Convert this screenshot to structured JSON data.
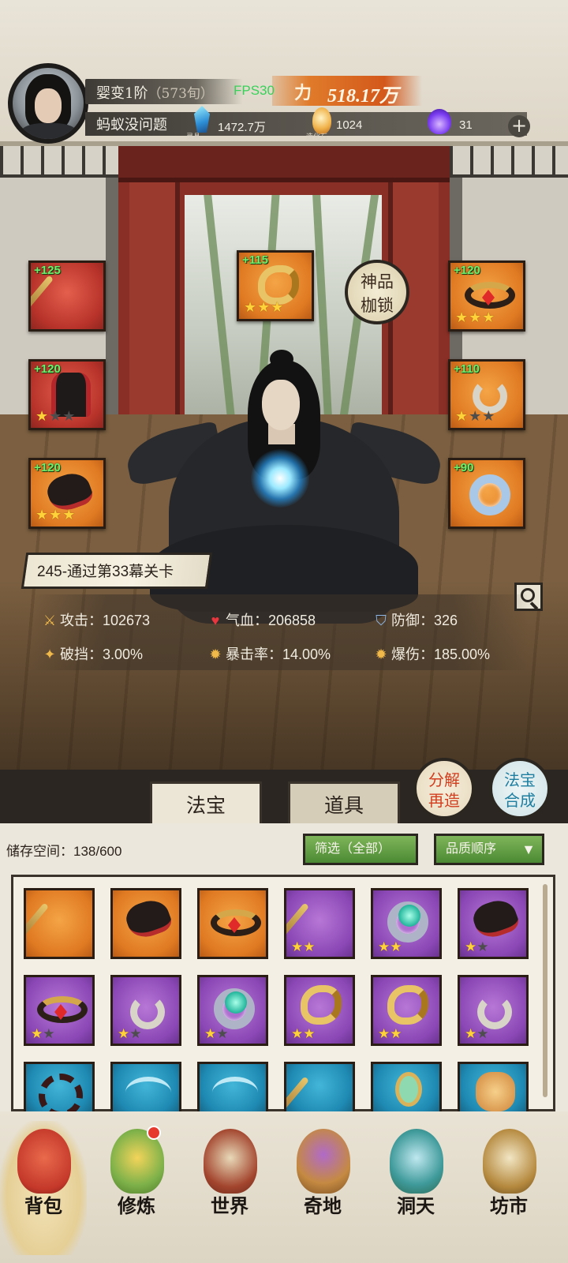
{
  "header": {
    "realm": "婴变1阶",
    "realm_age": "（573旬）",
    "fps": "FPS30",
    "power_label": "力",
    "power_value": "518.17万",
    "player_name": "蚂蚁没问题",
    "resources": [
      {
        "icon": "spirit-crystal-icon",
        "caption": "灵晶",
        "value": "1472.7万"
      },
      {
        "icon": "creation-stone-icon",
        "caption": "造化石",
        "value": "1024"
      },
      {
        "icon": "soul-flame-icon",
        "caption": "",
        "value": "31"
      }
    ],
    "plus_label": "+"
  },
  "equipment": {
    "slots": [
      {
        "bonus": "+125",
        "stars": 0,
        "max_stars": 0,
        "color": "#c0382d",
        "icon": "staff-icon"
      },
      {
        "bonus": "+115",
        "stars": 3,
        "max_stars": 3,
        "color": "#e07a22",
        "icon": "dragon-talisman-icon"
      },
      {
        "bonus": "+120",
        "stars": 3,
        "max_stars": 3,
        "color": "#e07a22",
        "icon": "crown-icon"
      },
      {
        "bonus": "+120",
        "stars": 1,
        "max_stars": 3,
        "color": "#c0382d",
        "icon": "robe-icon"
      },
      {
        "bonus": "+110",
        "stars": 1,
        "max_stars": 3,
        "color": "#e07a22",
        "icon": "pendant-icon"
      },
      {
        "bonus": "+120",
        "stars": 3,
        "max_stars": 3,
        "color": "#e07a22",
        "icon": "gauntlet-icon"
      },
      {
        "bonus": "+90",
        "stars": 0,
        "max_stars": 0,
        "color": "#e07a22",
        "icon": "ice-ring-icon"
      }
    ],
    "god_badge_line1": "神品",
    "god_badge_line2": "枷锁"
  },
  "stage": "245-通过第33幕关卡",
  "stats": {
    "attack": "攻击：102673",
    "hp": "气血：206858",
    "defense": "防御：326",
    "break": "破挡：3.00%",
    "crit_rate": "暴击率：14.00%",
    "crit_damage": "爆伤：185.00%"
  },
  "tabs": {
    "treasure": "法宝",
    "items": "道具"
  },
  "actions": {
    "decompose_line1": "分解",
    "decompose_line2": "再造",
    "synth_line1": "法宝",
    "synth_line2": "合成"
  },
  "inventory": {
    "storage": "储存空间：138/600",
    "filter": "筛选（全部）",
    "sort": "品质顺序",
    "cells": [
      {
        "rarity": "orange",
        "icon": "staff-icon",
        "stars": 0
      },
      {
        "rarity": "orange",
        "icon": "gauntlet-icon",
        "stars": 0
      },
      {
        "rarity": "orange",
        "icon": "crown-icon",
        "stars": 0
      },
      {
        "rarity": "purple",
        "icon": "staff-icon",
        "stars": 2
      },
      {
        "rarity": "purple",
        "icon": "jade-ring-icon",
        "stars": 2
      },
      {
        "rarity": "purple",
        "icon": "gauntlet-icon",
        "stars": 1
      },
      {
        "rarity": "purple",
        "icon": "crown-icon",
        "stars": 1
      },
      {
        "rarity": "purple",
        "icon": "pendant-icon",
        "stars": 1
      },
      {
        "rarity": "purple",
        "icon": "jade-ring-icon",
        "stars": 1
      },
      {
        "rarity": "purple",
        "icon": "dragon-talisman-icon",
        "stars": 2
      },
      {
        "rarity": "purple",
        "icon": "dragon-talisman-icon",
        "stars": 2
      },
      {
        "rarity": "purple",
        "icon": "pendant-icon",
        "stars": 1
      },
      {
        "rarity": "blue",
        "icon": "thorn-wheel-icon",
        "stars": 0
      },
      {
        "rarity": "blue",
        "icon": "bow-icon",
        "stars": 0
      },
      {
        "rarity": "blue",
        "icon": "bow-icon",
        "stars": 0
      },
      {
        "rarity": "blue",
        "icon": "staff-icon",
        "stars": 0
      },
      {
        "rarity": "blue",
        "icon": "mirror-icon",
        "stars": 0
      },
      {
        "rarity": "blue",
        "icon": "beast-icon",
        "stars": 0
      }
    ]
  },
  "nav": [
    {
      "label": "背包",
      "icon": "backpack-icon",
      "color": "#c4382a",
      "active": true
    },
    {
      "label": "修炼",
      "icon": "lotus-icon",
      "color": "#7fb24a",
      "active": false
    },
    {
      "label": "世界",
      "icon": "scroll-map-icon",
      "color": "#a3452e",
      "active": false
    },
    {
      "label": "奇地",
      "icon": "pagoda-icon",
      "color": "#c58a42",
      "active": false
    },
    {
      "label": "洞天",
      "icon": "portal-icon",
      "color": "#3f9a9a",
      "active": false
    },
    {
      "label": "坊市",
      "icon": "market-icon",
      "color": "#b5893e",
      "active": false
    }
  ]
}
